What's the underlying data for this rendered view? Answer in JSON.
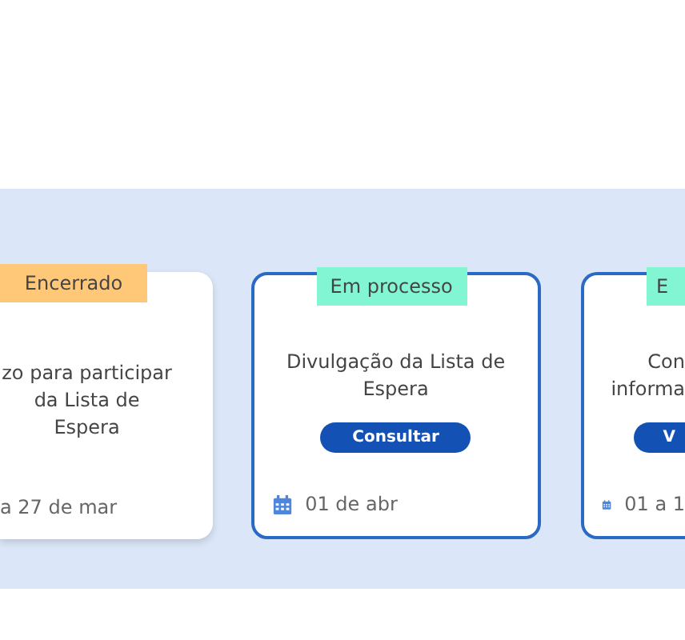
{
  "steps": [
    {
      "kind": "cut-left",
      "bordered": false,
      "status": {
        "label": "Encerrado",
        "color": "#ffc879"
      },
      "title": "zo para participar da Lista de Espera",
      "date": "a 27 de mar"
    },
    {
      "kind": "full",
      "bordered": true,
      "status": {
        "label": "Em processo",
        "color": "#82f5d3"
      },
      "title": "Divulgação da Lista de Espera",
      "button": "Consultar",
      "date": "01 de abr"
    },
    {
      "kind": "cut-right",
      "bordered": true,
      "status": {
        "label": "E",
        "color": "#82f5d3"
      },
      "title_lines": [
        "Con",
        "informa"
      ],
      "button": "V",
      "date": "01 a 1"
    }
  ]
}
